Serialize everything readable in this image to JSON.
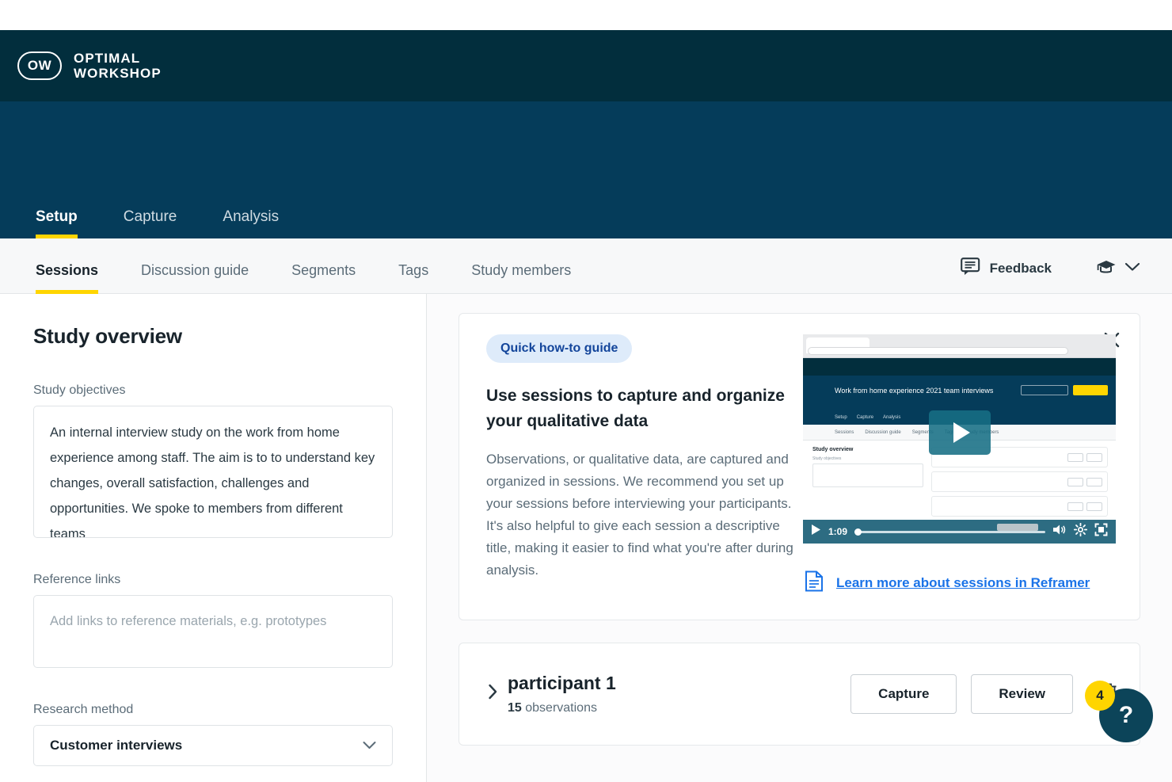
{
  "brand": {
    "logo_mark": "OW",
    "name_line1": "OPTIMAL",
    "name_line2": "WORKSHOP"
  },
  "primary_tabs": [
    {
      "label": "Setup",
      "active": true
    },
    {
      "label": "Capture",
      "active": false
    },
    {
      "label": "Analysis",
      "active": false
    }
  ],
  "sub_tabs": [
    {
      "label": "Sessions",
      "active": true
    },
    {
      "label": "Discussion guide",
      "active": false
    },
    {
      "label": "Segments",
      "active": false
    },
    {
      "label": "Tags",
      "active": false
    },
    {
      "label": "Study members",
      "active": false
    }
  ],
  "subnav_right": {
    "feedback_label": "Feedback",
    "feedback_icon": "speech-bubble-icon",
    "graduation_icon": "graduation-cap-icon",
    "chevron_icon": "chevron-down-icon"
  },
  "left_panel": {
    "title": "Study overview",
    "objectives_label": "Study objectives",
    "objectives_value": "An internal interview study on the work from home experience among staff. The aim is to to understand key changes, overall satisfaction, challenges and opportunities.\nWe spoke to members from different teams",
    "reference_label": "Reference links",
    "reference_placeholder": "Add links to reference materials, e.g. prototypes",
    "method_label": "Research method",
    "method_value": "Customer interviews"
  },
  "guide_card": {
    "pill": "Quick how-to guide",
    "heading": "Use sessions to capture and organize your qualitative data",
    "body": "Observations, or qualitative data, are captured and organized in sessions. We recommend you set up your sessions before interviewing your participants. It's also helpful to give each session a descriptive title, making it easier to find what you're after during analysis.",
    "close_icon": "close-icon",
    "learn_more_label": "Learn more about sessions in Reframer",
    "learn_more_icon": "document-icon"
  },
  "video": {
    "time": "1:09",
    "play_icon": "play-icon",
    "volume_icon": "volume-icon",
    "settings_icon": "gear-icon",
    "fullscreen_icon": "fullscreen-icon",
    "thumbnail_title": "Work from home experience 2021 team interviews",
    "thumbnail_tabs": [
      "Setup",
      "Capture",
      "Analysis"
    ],
    "thumbnail_subtabs": [
      "Sessions",
      "Discussion guide",
      "Segments",
      "Tags",
      "Study members"
    ],
    "thumbnail_panel_title": "Study overview",
    "thumbnail_field_label": "Study objectives"
  },
  "participant": {
    "name": "participant 1",
    "count": "15",
    "count_label": "observations",
    "expand_icon": "chevron-right-icon",
    "capture_label": "Capture",
    "review_label": "Review",
    "delete_icon": "trash-icon"
  },
  "help_fab": {
    "icon": "question-mark-icon",
    "badge": "4"
  },
  "colors": {
    "top_bar": "#022E3D",
    "hero": "#053C5A",
    "accent_yellow": "#FFD500",
    "link_blue": "#1A73E8",
    "pill_bg": "#DEEBFA",
    "pill_text": "#13459B"
  }
}
